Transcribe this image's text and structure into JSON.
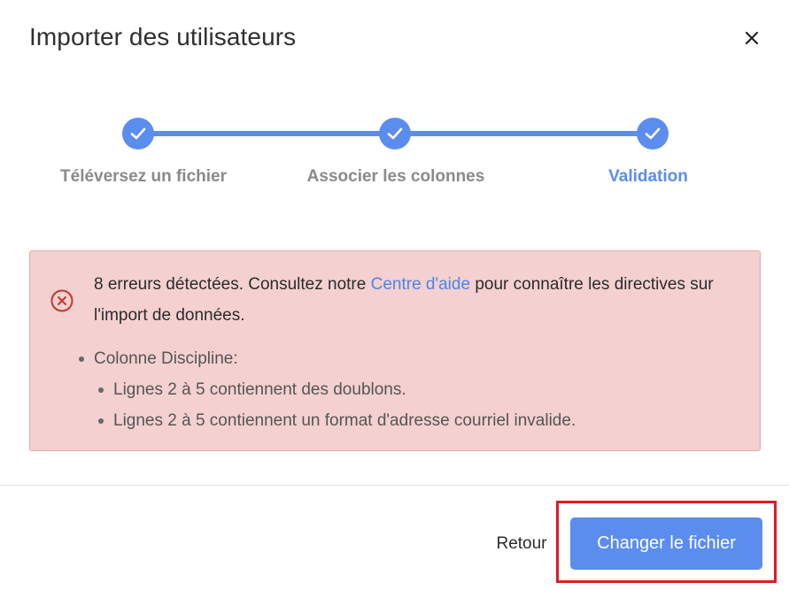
{
  "dialog": {
    "title": "Importer des utilisateurs",
    "close_icon": "close-icon"
  },
  "stepper": {
    "steps": [
      {
        "label": "Téléversez un fichier",
        "status": "completed",
        "active": false
      },
      {
        "label": "Associer les colonnes",
        "status": "completed",
        "active": false
      },
      {
        "label": "Validation",
        "status": "completed",
        "active": true
      }
    ],
    "accent_color": "#5b8def",
    "inactive_label_color": "#8a8a8a"
  },
  "alert": {
    "icon": "error-circle-x-icon",
    "message_before_link": "8 erreurs détectées. Consultez notre ",
    "link_text": "Centre d'aide",
    "message_after_link": " pour connaître les directives sur l'import de données.",
    "background_color": "#f4d0d0",
    "icon_color": "#c0392b",
    "link_color": "#4a86e8",
    "errors": [
      {
        "label": "Colonne Discipline:",
        "details": [
          "Lignes 2 à 5 contiennent des doublons.",
          "Lignes 2 à 5 contiennent un format d'adresse courriel invalide."
        ]
      }
    ]
  },
  "footer": {
    "back_label": "Retour",
    "primary_label": "Changer le fichier",
    "primary_color": "#5b8def",
    "highlight_color": "#e01b24"
  }
}
